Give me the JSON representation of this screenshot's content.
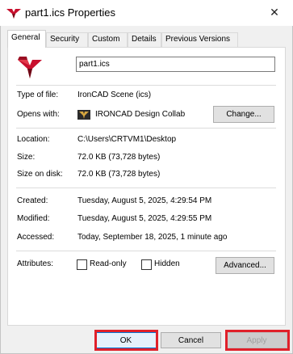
{
  "window": {
    "title": "part1.ics Properties",
    "close_glyph": "✕"
  },
  "tabs": [
    {
      "label": "General",
      "active": true
    },
    {
      "label": "Security"
    },
    {
      "label": "Custom"
    },
    {
      "label": "Details"
    },
    {
      "label": "Previous Versions"
    }
  ],
  "general": {
    "file_name": "part1.ics",
    "type_label": "Type of file:",
    "type_value": "IronCAD Scene (ics)",
    "opens_label": "Opens with:",
    "opens_value": "IRONCAD Design Collab",
    "change_button": "Change...",
    "location_label": "Location:",
    "location_value": "C:\\Users\\CRTVM1\\Desktop",
    "size_label": "Size:",
    "size_value": "72.0 KB (73,728 bytes)",
    "size_disk_label": "Size on disk:",
    "size_disk_value": "72.0 KB (73,728 bytes)",
    "created_label": "Created:",
    "created_value": "Tuesday, August 5, 2025, 4:29:54 PM",
    "modified_label": "Modified:",
    "modified_value": "Tuesday, August 5, 2025, 4:29:55 PM",
    "accessed_label": "Accessed:",
    "accessed_value": "Today, September 18, 2025, 1 minute ago",
    "attributes_label": "Attributes:",
    "readonly_label": "Read-only",
    "hidden_label": "Hidden",
    "advanced_button": "Advanced..."
  },
  "footer": {
    "ok": "OK",
    "cancel": "Cancel",
    "apply": "Apply"
  },
  "colors": {
    "brand_red": "#c8102e",
    "highlight": "#e0202a"
  },
  "icons": {
    "app": "ironcad-logo-icon",
    "opens_with": "ironcad-app-icon",
    "close": "close-icon"
  }
}
